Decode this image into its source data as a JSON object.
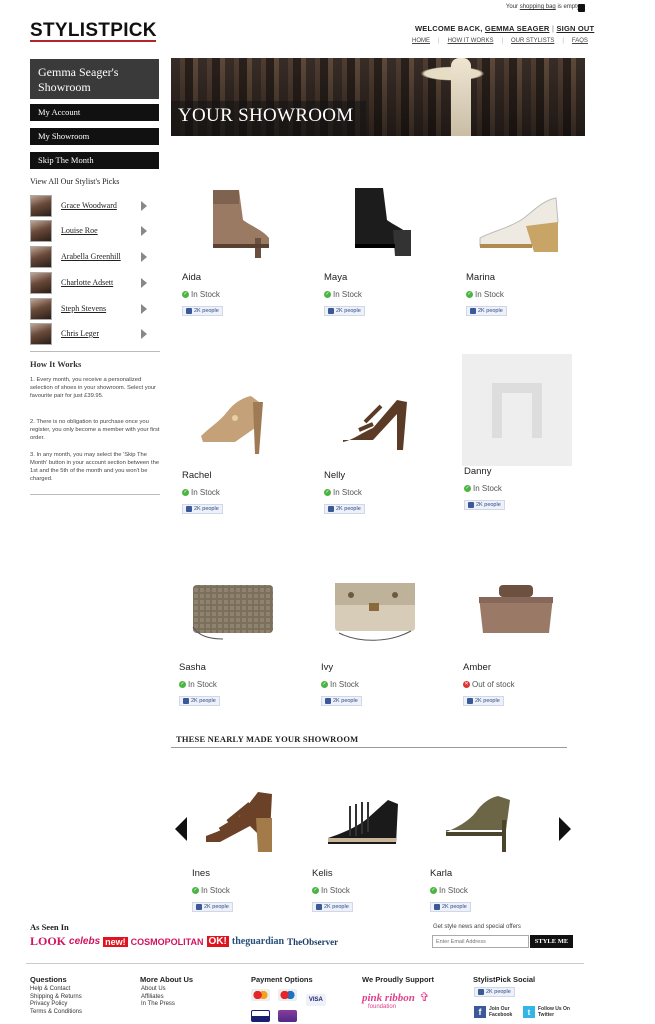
{
  "header": {
    "logo": "STYLISTPICK",
    "bag_prefix": "Your",
    "bag_link": "shopping bag",
    "bag_suffix": "is empty.",
    "welcome_prefix": "WELCOME BACK,",
    "user_name": "GEMMA SEAGER",
    "sign_out": "SIGN OUT",
    "nav": [
      "HOME",
      "HOW IT WORKS",
      "OUR STYLISTS",
      "FAQS"
    ]
  },
  "sidebar": {
    "title": "Gemma Seager's Showroom",
    "buttons": [
      "My Account",
      "My Showroom",
      "Skip The Month"
    ],
    "stylists_label": "View All Our Stylist's Picks",
    "stylists": [
      "Grace Woodward",
      "Louise Roe",
      "Arabella Greenhill",
      "Charlotte Adsett",
      "Steph Stevens",
      "Chris Leger"
    ],
    "how_title": "How It Works",
    "how_steps": [
      "1. Every month, you receive a personalized selection of shoes in your showroom. Select your favourite pair for just £39.95.",
      "2. There is no obligation to purchase once you register, you only become a member with your first order.",
      "3. In any month, you may select the 'Skip The Month' button in your account section between the 1st and the 5th of the month and you won't be charged."
    ]
  },
  "hero": {
    "title": "YOUR SHOWROOM"
  },
  "products": [
    {
      "name": "Aida",
      "stock": "In Stock",
      "likes": "2K people",
      "kind": "bootie-tan"
    },
    {
      "name": "Maya",
      "stock": "In Stock",
      "likes": "2K people",
      "kind": "bootie-black"
    },
    {
      "name": "Marina",
      "stock": "In Stock",
      "likes": "2K people",
      "kind": "wedge-white"
    },
    {
      "name": "Rachel",
      "stock": "In Stock",
      "likes": "2K people",
      "kind": "peep-tan"
    },
    {
      "name": "Nelly",
      "stock": "In Stock",
      "likes": "2K people",
      "kind": "sandal-brown"
    },
    {
      "name": "Danny",
      "stock": "In Stock",
      "likes": "2K people",
      "kind": "placeholder"
    },
    {
      "name": "Sasha",
      "stock": "In Stock",
      "likes": "2K people",
      "kind": "clutch-croc"
    },
    {
      "name": "Ivy",
      "stock": "In Stock",
      "likes": "2K people",
      "kind": "clutch-cream"
    },
    {
      "name": "Amber",
      "stock": "Out of stock",
      "likes": "2K people",
      "kind": "bag-tan"
    }
  ],
  "nearly": {
    "title": "THESE NEARLY MADE YOUR SHOWROOM",
    "items": [
      {
        "name": "Ines",
        "stock": "In Stock",
        "likes": "2K people",
        "kind": "platform-brown"
      },
      {
        "name": "Kelis",
        "stock": "In Stock",
        "likes": "2K people",
        "kind": "fringe-black"
      },
      {
        "name": "Karla",
        "stock": "In Stock",
        "likes": "2K people",
        "kind": "oxford-olive"
      }
    ]
  },
  "as_seen_in": {
    "title": "As Seen In",
    "logos": [
      "LOOK",
      "celebs",
      "new!",
      "COSMOPOLITAN",
      "OK!",
      "theguardian",
      "TheObserver"
    ]
  },
  "newsletter": {
    "label": "Get style news and special offers",
    "placeholder": "Enter Email Address",
    "button": "STYLE ME"
  },
  "footer": {
    "questions": {
      "title": "Questions",
      "items": [
        "Help & Contact",
        "Shipping & Returns",
        "Privacy Policy",
        "Terms & Conditions"
      ]
    },
    "more": {
      "title": "More About Us",
      "items": [
        "About Us",
        "Affiliates",
        "In The Press"
      ]
    },
    "payment": {
      "title": "Payment Options",
      "cards": [
        "mastercard",
        "maestro",
        "VISA",
        "visa-electron",
        "maestro-2"
      ]
    },
    "support": {
      "title": "We Proudly Support",
      "logo": "pink ribbon",
      "logo_sub": "foundation"
    },
    "social": {
      "title": "StylistPick Social",
      "likes": "2K people",
      "facebook": "Join Our Facebook",
      "twitter": "Follow Us On Twitter"
    }
  },
  "colors": {
    "accent": "#b0262b",
    "dark": "#111111",
    "stock_ok": "#4bb543",
    "stock_no": "#dd3333"
  }
}
